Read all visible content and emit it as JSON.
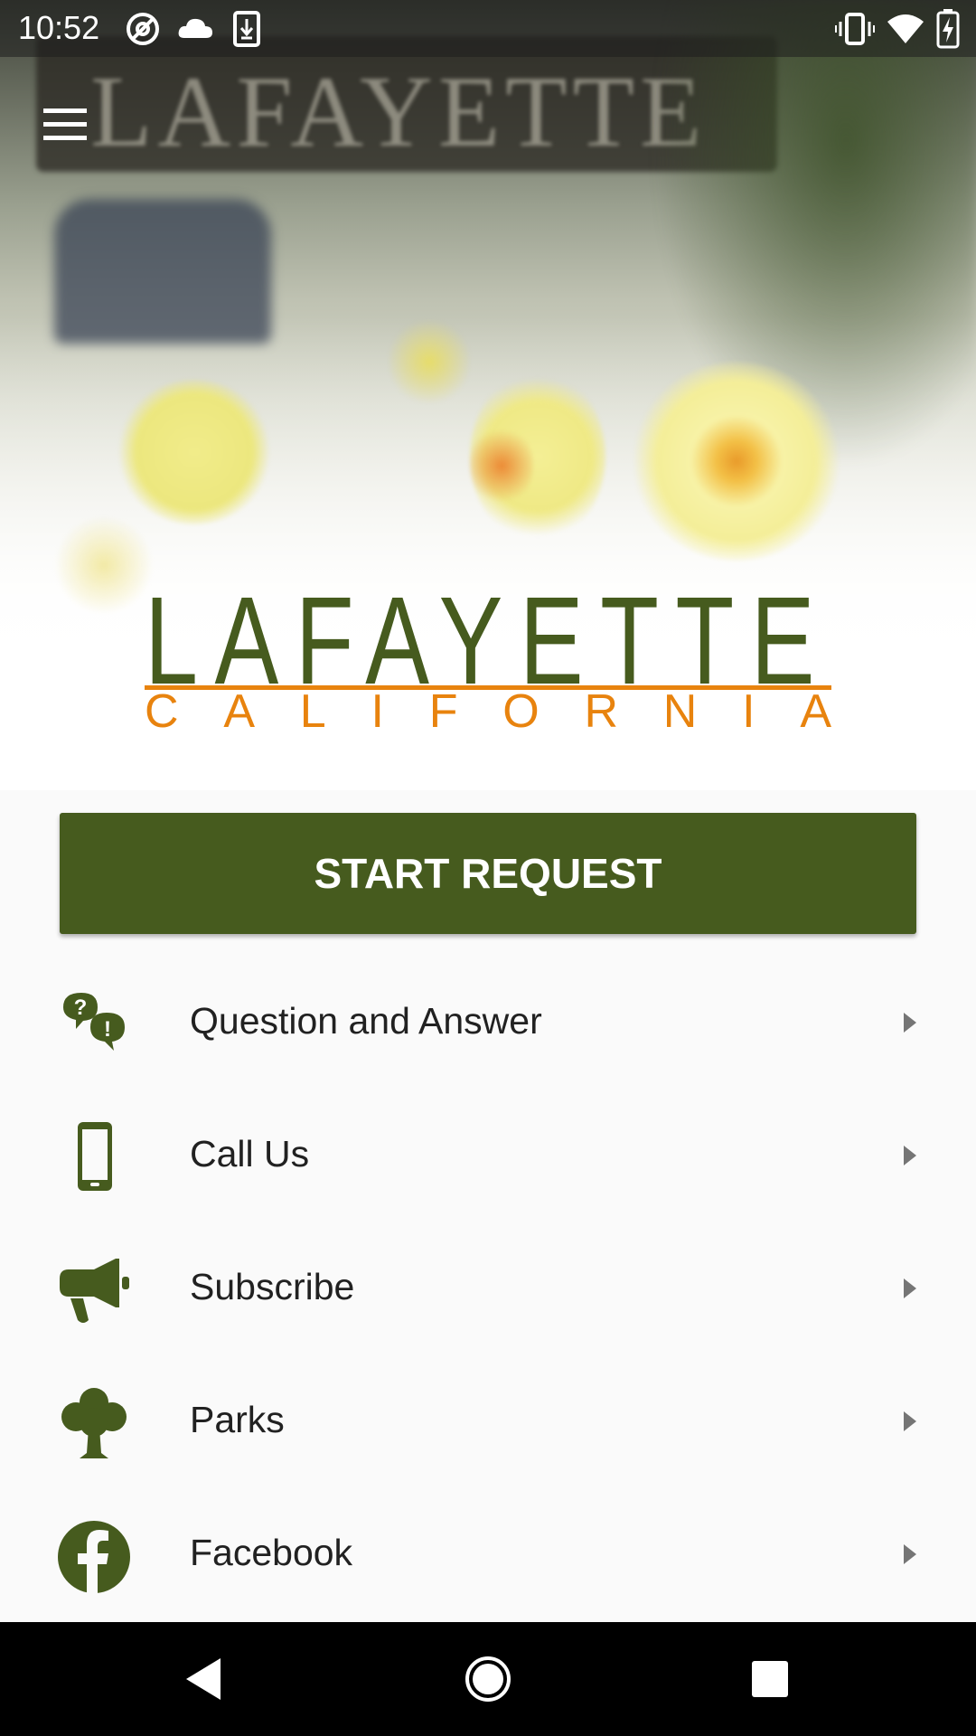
{
  "status_bar": {
    "time": "10:52",
    "left_icons": [
      "at-sign-icon",
      "cloud-icon",
      "download-icon"
    ],
    "right_icons": [
      "vibrate-icon",
      "wifi-icon",
      "battery-charging-icon"
    ]
  },
  "header": {
    "menu_icon": "hamburger-menu-icon"
  },
  "logo": {
    "title": "LAFAYETTE",
    "subtitle": "CALIFORNIA",
    "title_color": "#465b1e",
    "subtitle_color": "#e8830e"
  },
  "start_request": {
    "label": "START REQUEST",
    "color": "#465b1e"
  },
  "menu_items": [
    {
      "label": "Question and Answer",
      "icon": "question-answer-icon"
    },
    {
      "label": "Call Us",
      "icon": "phone-icon"
    },
    {
      "label": "Subscribe",
      "icon": "megaphone-icon"
    },
    {
      "label": "Parks",
      "icon": "tree-icon"
    },
    {
      "label": "Facebook",
      "icon": "facebook-icon"
    }
  ],
  "nav_bar": {
    "back_icon": "back-triangle-icon",
    "home_icon": "home-circle-icon",
    "recents_icon": "recents-square-icon"
  }
}
